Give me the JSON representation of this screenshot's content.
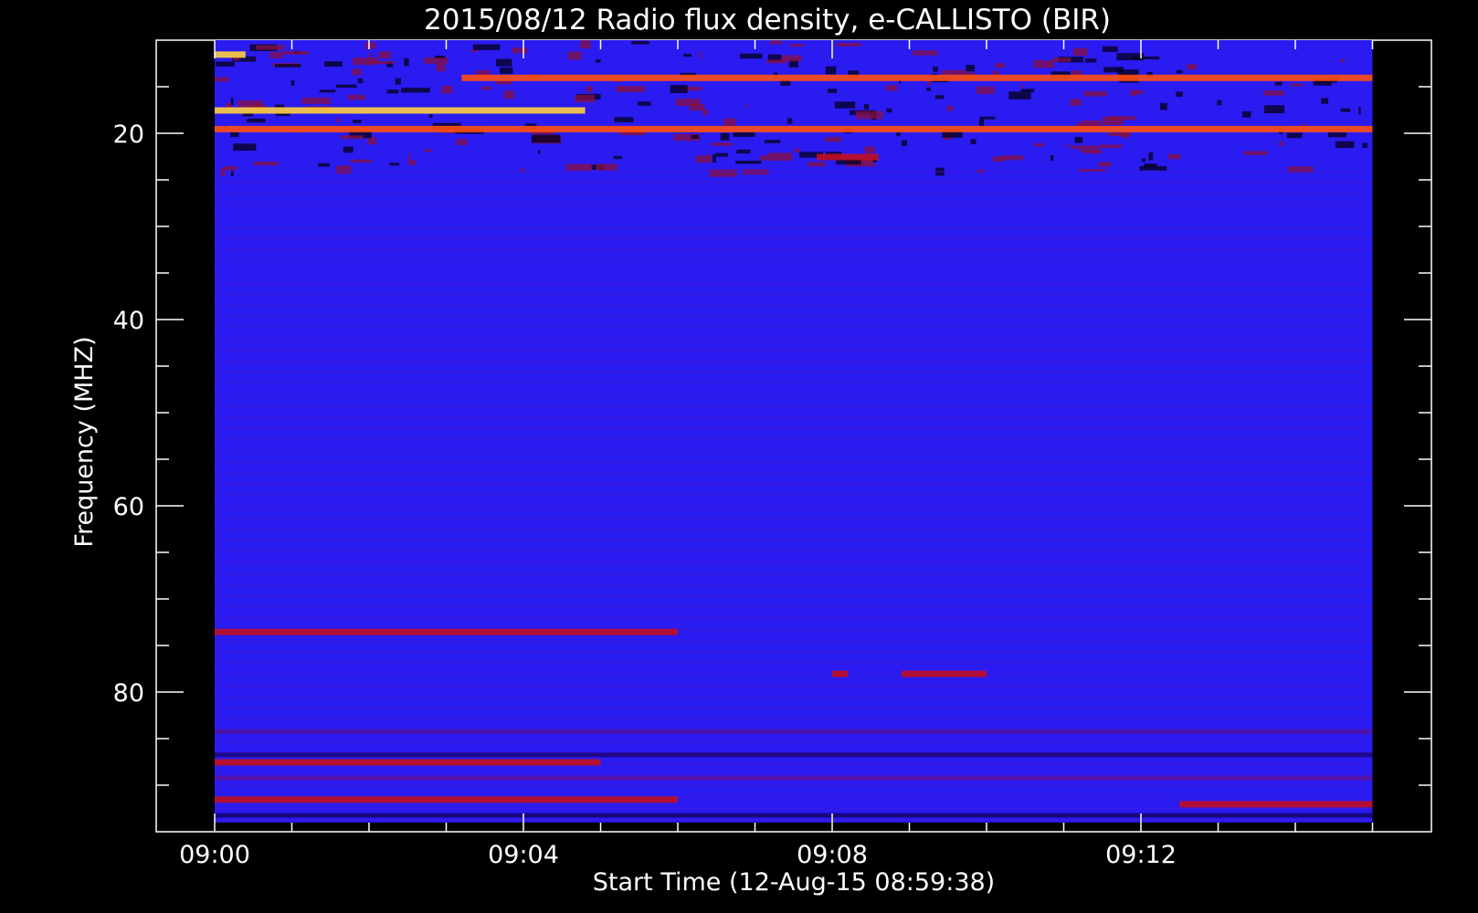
{
  "chart_data": {
    "type": "heatmap",
    "title": "2015/08/12  Radio flux density, e-CALLISTO (BIR)",
    "xlabel": "Start Time (12-Aug-15 08:59:38)",
    "ylabel": "Frequency (MHZ)",
    "x_ticks": [
      "09:00",
      "09:04",
      "09:08",
      "09:12"
    ],
    "x_tick_minutes": [
      0,
      4,
      8,
      12
    ],
    "x_data_range_minutes": [
      0,
      15
    ],
    "y_ticks": [
      20,
      40,
      60,
      80
    ],
    "y_range_mhz": [
      10,
      95
    ],
    "y_inverted": true,
    "y_data_range_mhz": [
      10,
      94
    ],
    "colormap": [
      "#000000",
      "#2a00ff",
      "#c00020",
      "#ff6000",
      "#ffff80"
    ],
    "background_color": "#2a1bf0",
    "features": [
      {
        "name": "rfi-band",
        "freq": 11.5,
        "t0": 0.0,
        "t1": 0.4,
        "level": 0.95
      },
      {
        "name": "rfi-band",
        "freq": 14.0,
        "t0": 3.2,
        "t1": 15.0,
        "level": 0.8
      },
      {
        "name": "rfi-band",
        "freq": 17.5,
        "t0": 0.0,
        "t1": 4.8,
        "level": 0.9
      },
      {
        "name": "rfi-band",
        "freq": 19.5,
        "t0": 0.0,
        "t1": 15.0,
        "level": 0.75
      },
      {
        "name": "rfi-band",
        "freq": 22.5,
        "t0": 7.8,
        "t1": 8.6,
        "level": 0.7
      },
      {
        "name": "emission-line",
        "freq": 73.5,
        "t0": 0.0,
        "t1": 6.0,
        "level": 0.45
      },
      {
        "name": "emission-line",
        "freq": 78.0,
        "t0": 8.0,
        "t1": 8.2,
        "level": 0.55
      },
      {
        "name": "emission-line",
        "freq": 78.0,
        "t0": 8.9,
        "t1": 10.0,
        "level": 0.55
      },
      {
        "name": "emission-line",
        "freq": 87.5,
        "t0": 0.0,
        "t1": 5.0,
        "level": 0.45
      },
      {
        "name": "emission-line",
        "freq": 91.5,
        "t0": 0.0,
        "t1": 6.0,
        "level": 0.4
      },
      {
        "name": "emission-line",
        "freq": 92.0,
        "t0": 12.5,
        "t1": 15.0,
        "level": 0.45
      }
    ]
  }
}
